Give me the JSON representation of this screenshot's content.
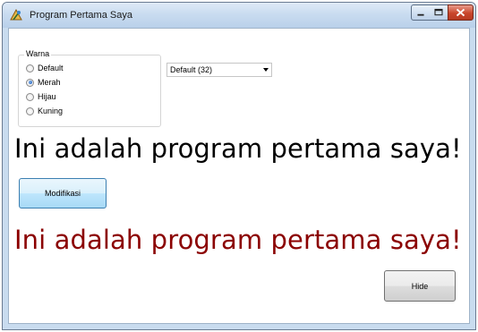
{
  "window": {
    "title": "Program Pertama Saya"
  },
  "warna_group": {
    "caption": "Warna",
    "options": [
      {
        "label": "Default",
        "checked": false
      },
      {
        "label": "Merah",
        "checked": true
      },
      {
        "label": "Hijau",
        "checked": false
      },
      {
        "label": "Kuning",
        "checked": false
      }
    ]
  },
  "combo": {
    "selected": "Default (32)"
  },
  "label_black": {
    "text": "Ini adalah program pertama saya!",
    "color": "#000000"
  },
  "label_red": {
    "text": "Ini adalah program pertama saya!",
    "color": "#8b0000"
  },
  "buttons": {
    "modifikasi": "Modifikasi",
    "hide": "Hide"
  },
  "icons": {
    "app": "app-icon",
    "minimize": "minimize-icon",
    "maximize": "maximize-icon",
    "close": "close-icon",
    "dropdown": "chevron-down-icon"
  }
}
